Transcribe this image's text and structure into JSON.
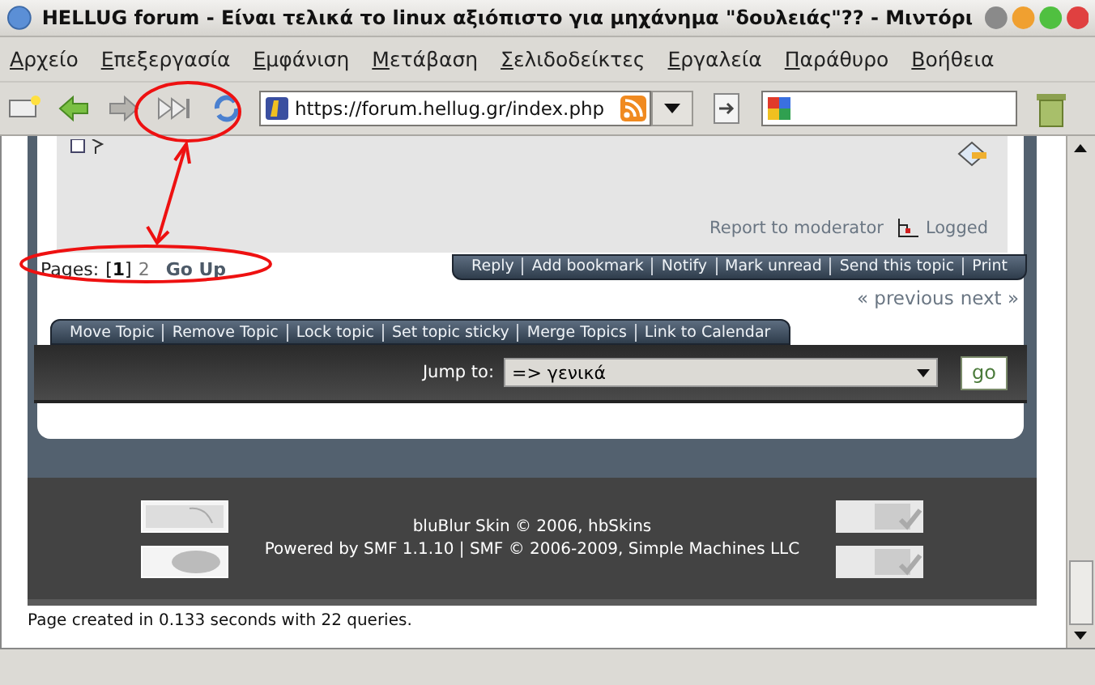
{
  "window": {
    "title": "HELLUG forum - Είναι τελικά το linux αξιόπιστο για μηχάνημα \"δουλειάς\"?? - Μιντόρι"
  },
  "menu": [
    "Αρχείο",
    "Επεξεργασία",
    "Εμφάνιση",
    "Μετάβαση",
    "Σελιδοδείκτες",
    "Εργαλεία",
    "Παράθυρο",
    "Βοήθεια"
  ],
  "address": {
    "value": "https://forum.hellug.gr/index.php"
  },
  "post": {
    "report": "Report to moderator",
    "logged": "Logged"
  },
  "pages": {
    "label": "Pages:",
    "items": [
      {
        "text": "[**1**]",
        "selected": true
      },
      {
        "text": "2",
        "selected": false
      }
    ],
    "go_up": "Go Up"
  },
  "topic_actions": [
    "Reply",
    "Add bookmark",
    "Notify",
    "Mark unread",
    "Send this topic",
    "Print"
  ],
  "nav": {
    "previous": "« previous",
    "next": "next »"
  },
  "mod_actions": [
    "Move Topic",
    "Remove Topic",
    "Lock topic",
    "Set topic sticky",
    "Merge Topics",
    "Link to Calendar"
  ],
  "jump": {
    "label": "Jump to:",
    "value": "=> γενικά",
    "button": "go"
  },
  "footer": {
    "skin": "bluBlur Skin © 2006, hbSkins",
    "powered": "Powered by SMF 1.1.10 | SMF © 2006-2009, Simple Machines LLC"
  },
  "page_created": "Page created in 0.133 seconds with 22 queries."
}
